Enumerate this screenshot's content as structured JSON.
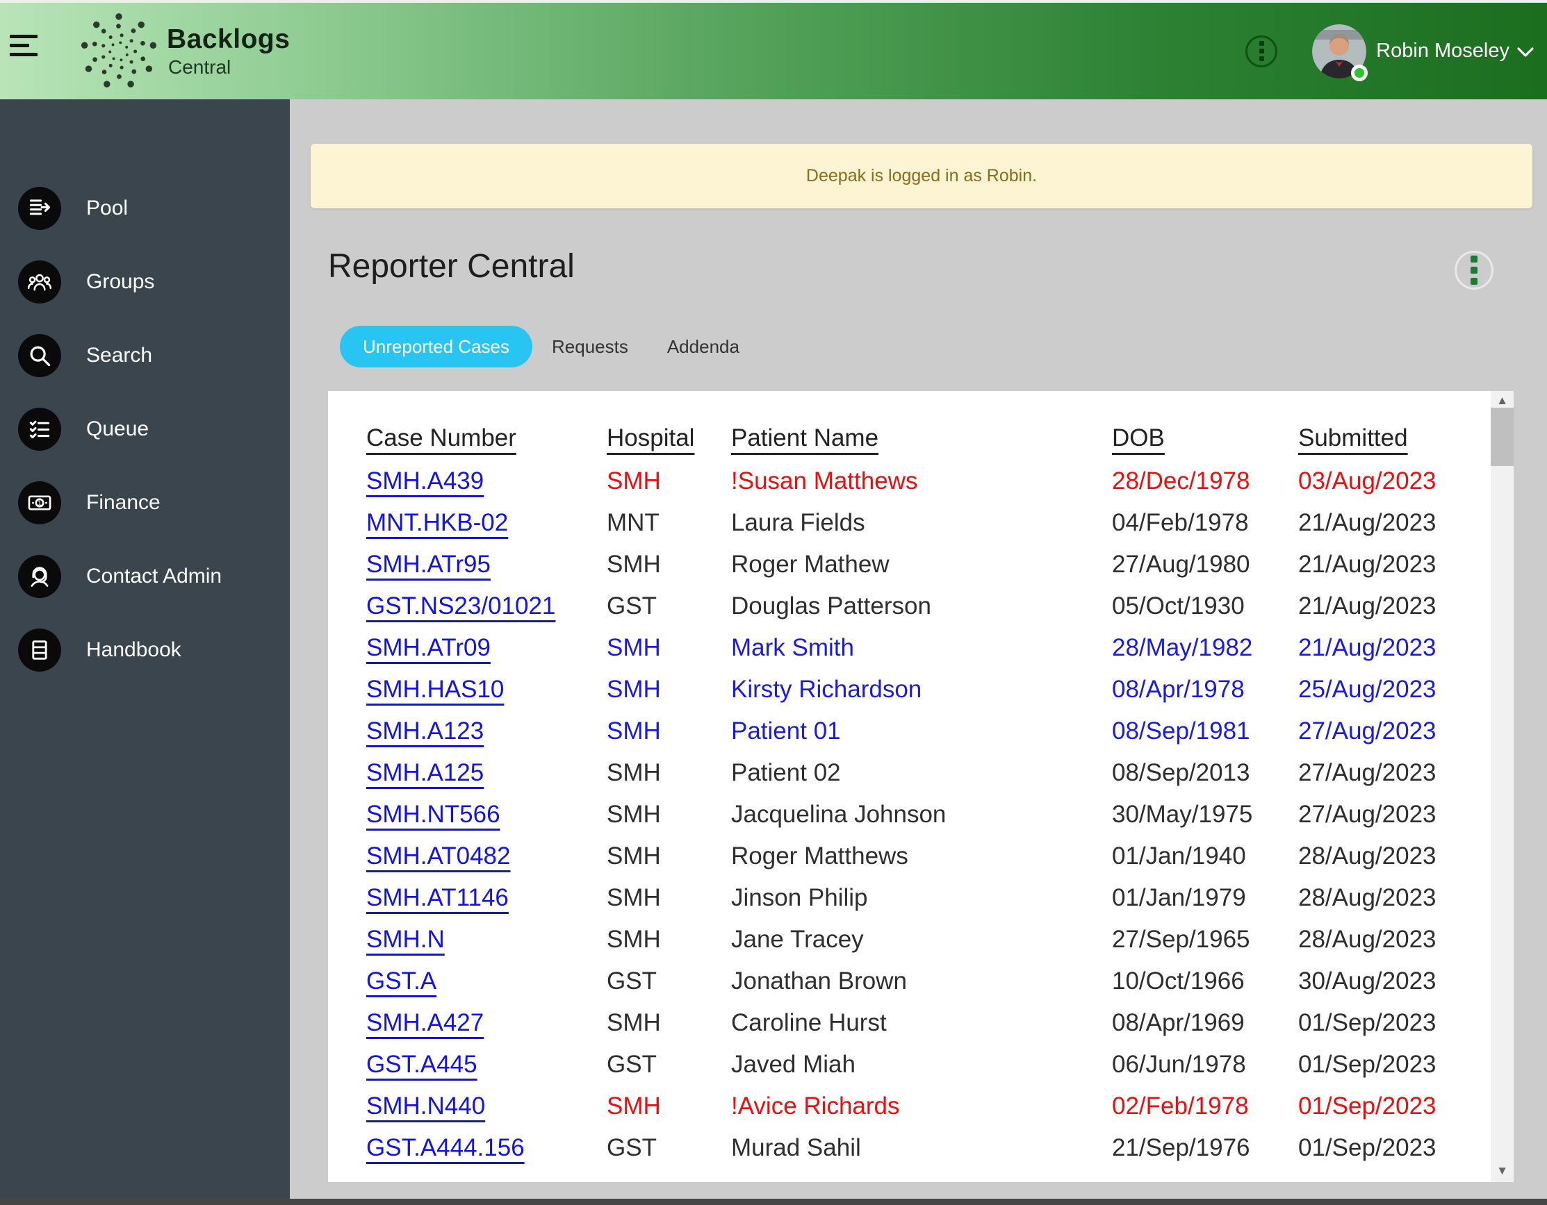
{
  "header": {
    "logo": {
      "title": "Backlogs",
      "subtitle": "Central"
    },
    "user": {
      "name": "Robin Moseley",
      "status": "online"
    }
  },
  "sidebar": {
    "items": [
      {
        "label": "Pool",
        "icon": "pool-icon"
      },
      {
        "label": "Groups",
        "icon": "groups-icon"
      },
      {
        "label": "Search",
        "icon": "search-icon"
      },
      {
        "label": "Queue",
        "icon": "queue-icon"
      },
      {
        "label": "Finance",
        "icon": "finance-icon"
      },
      {
        "label": "Contact Admin",
        "icon": "contact-admin-icon"
      },
      {
        "label": "Handbook",
        "icon": "handbook-icon"
      }
    ]
  },
  "main": {
    "banner": {
      "text": "Deepak is logged in as Robin."
    },
    "title": "Reporter Central",
    "tabs": [
      {
        "label": "Unreported Cases",
        "active": true
      },
      {
        "label": "Requests",
        "active": false
      },
      {
        "label": "Addenda",
        "active": false
      }
    ],
    "table": {
      "columns": [
        "Case Number",
        "Hospital",
        "Patient Name",
        "DOB",
        "Submitted"
      ],
      "rows": [
        {
          "case_number": "SMH.A439",
          "hospital": "SMH",
          "patient_name": "!Susan Matthews",
          "dob": "28/Dec/1978",
          "submitted": "03/Aug/2023",
          "color": "red"
        },
        {
          "case_number": "MNT.HKB-02",
          "hospital": "MNT",
          "patient_name": "Laura Fields",
          "dob": "04/Feb/1978",
          "submitted": "21/Aug/2023",
          "color": "black"
        },
        {
          "case_number": "SMH.ATr95",
          "hospital": "SMH",
          "patient_name": "Roger Mathew",
          "dob": "27/Aug/1980",
          "submitted": "21/Aug/2023",
          "color": "black"
        },
        {
          "case_number": "GST.NS23/01021",
          "hospital": "GST",
          "patient_name": "Douglas Patterson",
          "dob": "05/Oct/1930",
          "submitted": "21/Aug/2023",
          "color": "black"
        },
        {
          "case_number": "SMH.ATr09",
          "hospital": "SMH",
          "patient_name": "Mark Smith",
          "dob": "28/May/1982",
          "submitted": "21/Aug/2023",
          "color": "blue"
        },
        {
          "case_number": "SMH.HAS10",
          "hospital": "SMH",
          "patient_name": "Kirsty Richardson",
          "dob": "08/Apr/1978",
          "submitted": "25/Aug/2023",
          "color": "blue"
        },
        {
          "case_number": "SMH.A123",
          "hospital": "SMH",
          "patient_name": "Patient 01",
          "dob": "08/Sep/1981",
          "submitted": "27/Aug/2023",
          "color": "blue"
        },
        {
          "case_number": "SMH.A125",
          "hospital": "SMH",
          "patient_name": "Patient 02",
          "dob": "08/Sep/2013",
          "submitted": "27/Aug/2023",
          "color": "black"
        },
        {
          "case_number": "SMH.NT566",
          "hospital": "SMH",
          "patient_name": "Jacquelina Johnson",
          "dob": "30/May/1975",
          "submitted": "27/Aug/2023",
          "color": "black"
        },
        {
          "case_number": "SMH.AT0482",
          "hospital": "SMH",
          "patient_name": "Roger Matthews",
          "dob": "01/Jan/1940",
          "submitted": "28/Aug/2023",
          "color": "black"
        },
        {
          "case_number": "SMH.AT1146",
          "hospital": "SMH",
          "patient_name": "Jinson Philip",
          "dob": "01/Jan/1979",
          "submitted": "28/Aug/2023",
          "color": "black"
        },
        {
          "case_number": "SMH.N",
          "hospital": "SMH",
          "patient_name": "Jane Tracey",
          "dob": "27/Sep/1965",
          "submitted": "28/Aug/2023",
          "color": "black"
        },
        {
          "case_number": "GST.A",
          "hospital": "GST",
          "patient_name": "Jonathan Brown",
          "dob": "10/Oct/1966",
          "submitted": "30/Aug/2023",
          "color": "black"
        },
        {
          "case_number": "SMH.A427",
          "hospital": "SMH",
          "patient_name": "Caroline Hurst",
          "dob": "08/Apr/1969",
          "submitted": "01/Sep/2023",
          "color": "black"
        },
        {
          "case_number": "GST.A445",
          "hospital": "GST",
          "patient_name": "Javed Miah",
          "dob": "06/Jun/1978",
          "submitted": "01/Sep/2023",
          "color": "black"
        },
        {
          "case_number": "SMH.N440",
          "hospital": "SMH",
          "patient_name": "!Avice Richards",
          "dob": "02/Feb/1978",
          "submitted": "01/Sep/2023",
          "color": "red"
        },
        {
          "case_number": "GST.A444.156",
          "hospital": "GST",
          "patient_name": "Murad Sahil",
          "dob": "21/Sep/1976",
          "submitted": "01/Sep/2023",
          "color": "black"
        }
      ]
    }
  },
  "colors": {
    "header_gradient_start": "#b9e4b9",
    "header_gradient_end": "#1b6e1e",
    "sidebar_bg": "#3a454e",
    "active_tab": "#29c5f2",
    "banner_bg": "#fcf4d2",
    "banner_text": "#8a6c1d",
    "link_blue": "#1212ea",
    "row_blue": "#1a1ae8",
    "row_red": "#ee0d0d",
    "row_default": "#2e2e2e"
  }
}
